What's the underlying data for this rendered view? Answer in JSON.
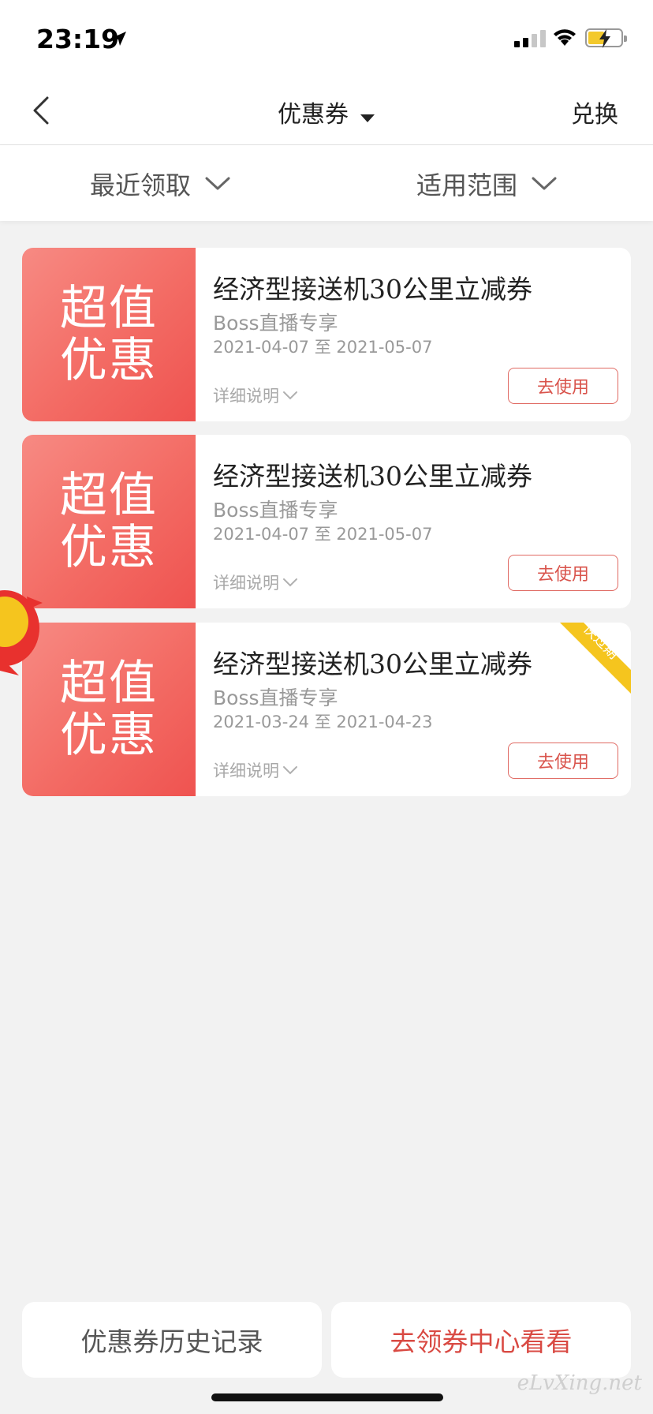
{
  "status_bar": {
    "time": "23:19"
  },
  "nav": {
    "title": "优惠券",
    "exchange_label": "兑换"
  },
  "filters": {
    "recent_label": "最近领取",
    "scope_label": "适用范围"
  },
  "coupons": [
    {
      "badge_line1": "超值",
      "badge_line2": "优惠",
      "title": "经济型接送机30公里立减券",
      "subtitle": "Boss直播专享",
      "dates": "2021-04-07 至 2021-05-07",
      "detail_label": "详细说明",
      "use_label": "去使用",
      "expiring": false
    },
    {
      "badge_line1": "超值",
      "badge_line2": "优惠",
      "title": "经济型接送机30公里立减券",
      "subtitle": "Boss直播专享",
      "dates": "2021-04-07 至 2021-05-07",
      "detail_label": "详细说明",
      "use_label": "去使用",
      "expiring": false
    },
    {
      "badge_line1": "超值",
      "badge_line2": "优惠",
      "title": "经济型接送机30公里立减券",
      "subtitle": "Boss直播专享",
      "dates": "2021-03-24 至 2021-04-23",
      "detail_label": "详细说明",
      "use_label": "去使用",
      "expiring": true,
      "expiring_label": "快过期"
    }
  ],
  "footer": {
    "history_label": "优惠券历史记录",
    "coupon_center_label": "去领券中心看看"
  },
  "watermark": "eLvXing.net",
  "colors": {
    "accent_red": "#ef5350",
    "ribbon_yellow": "#f5c51e",
    "background": "#f2f2f2"
  }
}
